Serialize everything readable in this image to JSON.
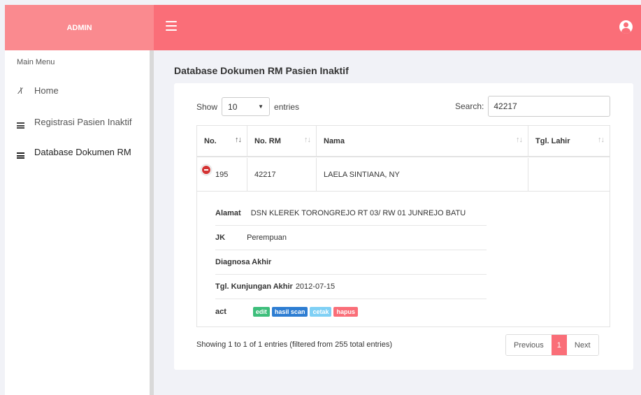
{
  "app": {
    "brand": "ADMIN"
  },
  "colors": {
    "accent": "#fa6e78",
    "brand_bg": "#fa8a8f",
    "badge_edit": "#3dbe7b",
    "badge_scan": "#2d7dd2",
    "badge_cetak": "#7fd0f5",
    "badge_hapus": "#fa6e78"
  },
  "icons": {
    "menu": "hamburger-icon",
    "user": "user-circle-icon",
    "home": "dashboard-gauge-icon",
    "list": "list-icon",
    "row_toggle": "minus-circle-icon"
  },
  "sidebar": {
    "title": "Main Menu",
    "items": [
      {
        "label": "Home",
        "icon": "dashboard-gauge-icon"
      },
      {
        "label": "Registrasi Pasien Inaktif",
        "icon": "list-icon"
      },
      {
        "label": "Database Dokumen RM",
        "icon": "list-icon",
        "active": true
      }
    ]
  },
  "main": {
    "title": "Database Dokumen RM Pasien Inaktif"
  },
  "table_controls": {
    "show_label": "Show",
    "entries_value": "10",
    "entries_label": "entries",
    "search_label": "Search:",
    "search_value": "42217"
  },
  "table": {
    "columns": [
      "No.",
      "No. RM",
      "Nama",
      "Tgl. Lahir"
    ],
    "rows": [
      {
        "no": "195",
        "no_rm": "42217",
        "nama": "LAELA SINTIANA, NY",
        "tgl_lahir": ""
      }
    ]
  },
  "detail": {
    "alamat_label": "Alamat",
    "alamat_value": "DSN KLEREK TORONGREJO RT 03/ RW 01 JUNREJO BATU",
    "jk_label": "JK",
    "jk_value": "Perempuan",
    "diagnosa_label": "Diagnosa Akhir",
    "diagnosa_value": "",
    "kunjungan_label": "Tgl. Kunjungan Akhir",
    "kunjungan_value": "2012-07-15",
    "act_label": "act",
    "actions": [
      "edit",
      "hasil scan",
      "cetak",
      "hapus"
    ]
  },
  "footer": {
    "info": "Showing 1 to 1 of 1 entries (filtered from 255 total entries)",
    "prev": "Previous",
    "page": "1",
    "next": "Next"
  }
}
